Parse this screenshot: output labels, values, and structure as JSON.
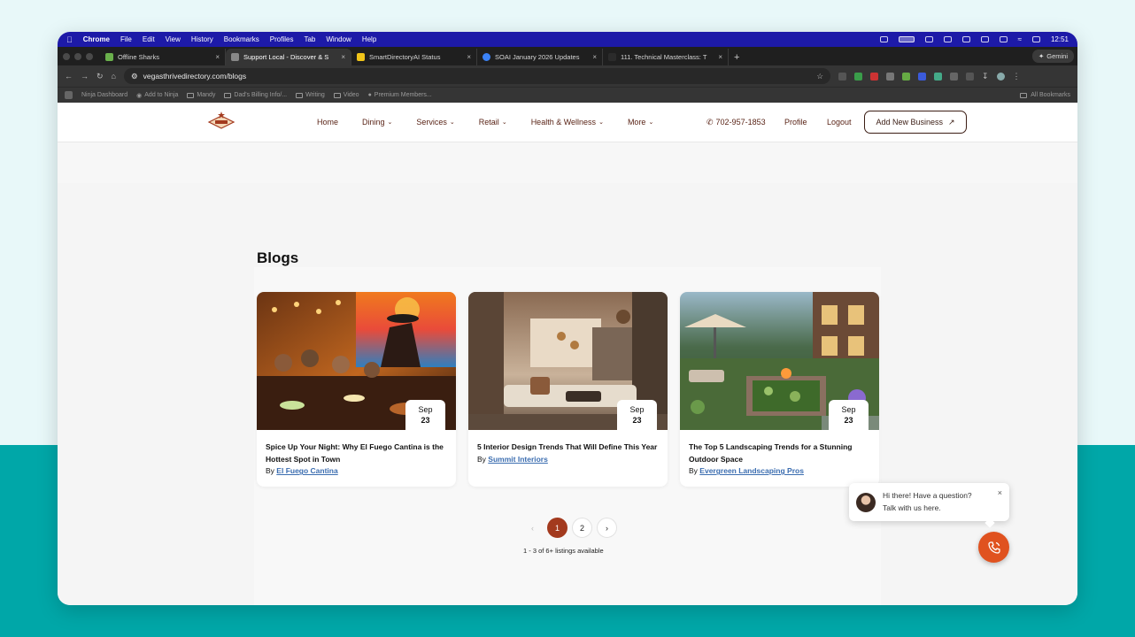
{
  "macos_menubar": {
    "app_name": "Chrome",
    "menus": [
      "File",
      "Edit",
      "View",
      "History",
      "Bookmarks",
      "Profiles",
      "Tab",
      "Window",
      "Help"
    ],
    "clock": "12:51"
  },
  "browser": {
    "tabs": [
      {
        "title": "Offline Sharks",
        "active": false,
        "favicon_color": "#6ab04c"
      },
      {
        "title": "Support Local - Discover & S",
        "active": true,
        "favicon_color": "#888888"
      },
      {
        "title": "SmartDirectoryAI Status",
        "active": false,
        "favicon_color": "#f0c419"
      },
      {
        "title": "SOAI January 2026 Updates",
        "active": false,
        "favicon_color": "#3b82f6"
      },
      {
        "title": "111. Technical Masterclass: T",
        "active": false,
        "favicon_color": "#2b2b2b"
      }
    ],
    "new_tab_label": "+",
    "gemini_label": "Gemini",
    "url": "vegasthrivedirectory.com/blogs",
    "bookmarks": [
      "Ninja Dashboard",
      "Add to Ninja",
      "Mandy",
      "Dad's Billing Info/...",
      "Writing",
      "Video",
      "Premium Members..."
    ],
    "all_bookmarks": "All Bookmarks"
  },
  "site": {
    "nav": [
      {
        "label": "Home",
        "dropdown": false
      },
      {
        "label": "Dining",
        "dropdown": true
      },
      {
        "label": "Services",
        "dropdown": true
      },
      {
        "label": "Retail",
        "dropdown": true
      },
      {
        "label": "Health & Wellness",
        "dropdown": true
      },
      {
        "label": "More",
        "dropdown": true
      }
    ],
    "phone": "702-957-1853",
    "profile": "Profile",
    "logout": "Logout",
    "add_business": "Add New Business",
    "brand_color": "#a33a1e"
  },
  "page": {
    "heading": "Blogs",
    "posts": [
      {
        "month": "Sep",
        "day": "23",
        "title": "Spice Up Your Night: Why El Fuego Cantina is the Hottest Spot in Town",
        "by": "By",
        "author": "El Fuego Cantina"
      },
      {
        "month": "Sep",
        "day": "23",
        "title": "5 Interior Design Trends That Will Define This Year",
        "by": "By",
        "author": "Summit Interiors"
      },
      {
        "month": "Sep",
        "day": "23",
        "title": "The Top 5 Landscaping Trends for a Stunning Outdoor Space",
        "by": "By",
        "author": "Evergreen Landscaping Pros"
      }
    ],
    "pagination": {
      "prev": "‹",
      "pages": [
        "1",
        "2"
      ],
      "next": "›",
      "current": "1"
    },
    "listing_count": "1 - 3 of 6+ listings available"
  },
  "chat": {
    "line1": "Hi there! Have a question?",
    "line2": "Talk with us here.",
    "close": "×"
  }
}
